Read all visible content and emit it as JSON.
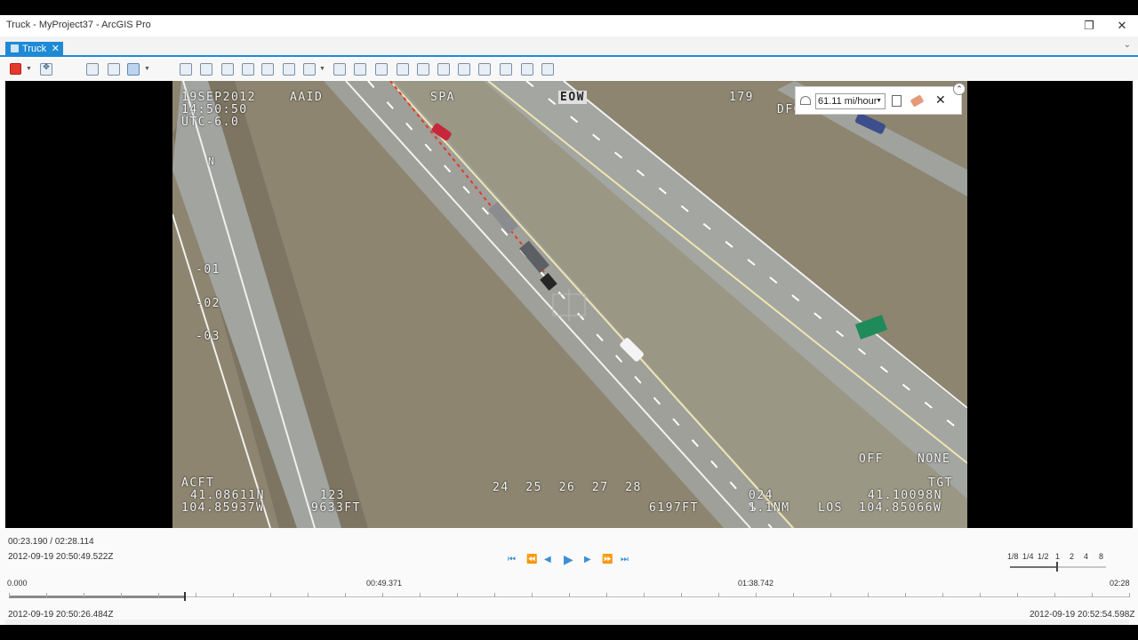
{
  "window": {
    "title": "Truck - MyProject37 - ArcGIS Pro",
    "restore_icon": "restore-icon",
    "close_icon": "close-icon"
  },
  "tab": {
    "label": "Truck",
    "close": "✕"
  },
  "toolbar": {
    "icons": [
      "color-swatch-icon",
      "pan-icon",
      "select-icon",
      "zoom-to-icon",
      "bookmark-icon",
      "measure-icon",
      "zoom-in-icon",
      "identify-icon",
      "locate-icon",
      "arrow-icon",
      "link-icon",
      "grid-icon",
      "frame-icon",
      "capture-icon",
      "tool-icon",
      "tool-icon",
      "tool-icon",
      "tool-icon",
      "tool-icon",
      "tool-icon",
      "tool-icon",
      "tool-icon",
      "tool-icon",
      "tool-icon"
    ],
    "accent": "#e6392c"
  },
  "overlay": {
    "date": "19SEP2012",
    "aaid": "AAID",
    "spa": "SPA",
    "eow": "EOW",
    "heading": "179",
    "dfov_partial": "DFO",
    "time": "14:50:50",
    "utc": "UTC-6.0",
    "north": "N",
    "scale_01": "-01",
    "scale_02": "-02",
    "scale_03": "-03",
    "off": "OFF",
    "none": "NONE",
    "acft": "ACFT",
    "acft_lat": "41.08611N",
    "acft_alt_num": "123",
    "acft_lon": "104.85937W",
    "acft_alt": "9633FT",
    "tape": "24  25  26  27  28",
    "tgt_alt": "6197FT",
    "range_num": "024",
    "range": "1.1NM",
    "los": "LOS",
    "tgt": "TGT",
    "tgt_lat": "41.10098N",
    "tgt_lon": "104.85066W"
  },
  "speed_panel": {
    "value": "61.11 mi/hour"
  },
  "controls": {
    "current_time": "00:23.190 / 02:28.114",
    "current_timestamp": "2012-09-19 20:50:49.522Z",
    "start_timestamp": "2012-09-19 20:50:26.484Z",
    "end_timestamp": "2012-09-19 20:52:54.598Z",
    "timeline_labels": [
      "0.000",
      "00:49.371",
      "01:38.742",
      "02:28"
    ],
    "playback_rates": [
      "1/8",
      "1/4",
      "1/2",
      "1",
      "2",
      "4",
      "8"
    ],
    "playback_position": 0.157,
    "rate_position": 0.49
  }
}
